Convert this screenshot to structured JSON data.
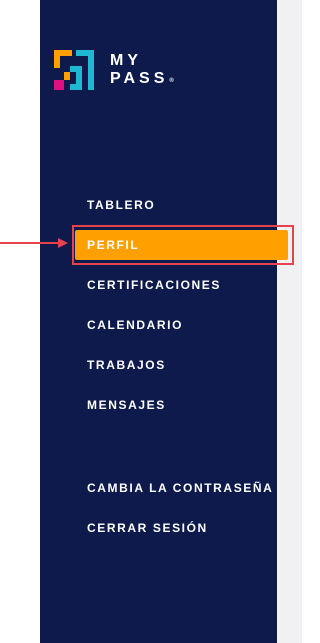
{
  "brand": {
    "line1": "MY",
    "line2": "PASS",
    "registered": "®"
  },
  "nav": {
    "items": [
      {
        "label": "TABLERO"
      },
      {
        "label": "PERFIL",
        "active": true
      },
      {
        "label": "CERTIFICACIONES"
      },
      {
        "label": "CALENDARIO"
      },
      {
        "label": "TRABAJOS"
      },
      {
        "label": "MENSAJES"
      }
    ],
    "account": [
      {
        "label": "CAMBIA LA CONTRASEÑA"
      },
      {
        "label": "CERRAR SESIÓN"
      }
    ]
  },
  "annotation": {
    "color": "#e8424a"
  },
  "colors": {
    "sidebar": "#0d1a4b",
    "active": "#ff9f00",
    "logo_orange": "#ff9f00",
    "logo_magenta": "#e0117f",
    "logo_cyan": "#1fb8d3"
  }
}
